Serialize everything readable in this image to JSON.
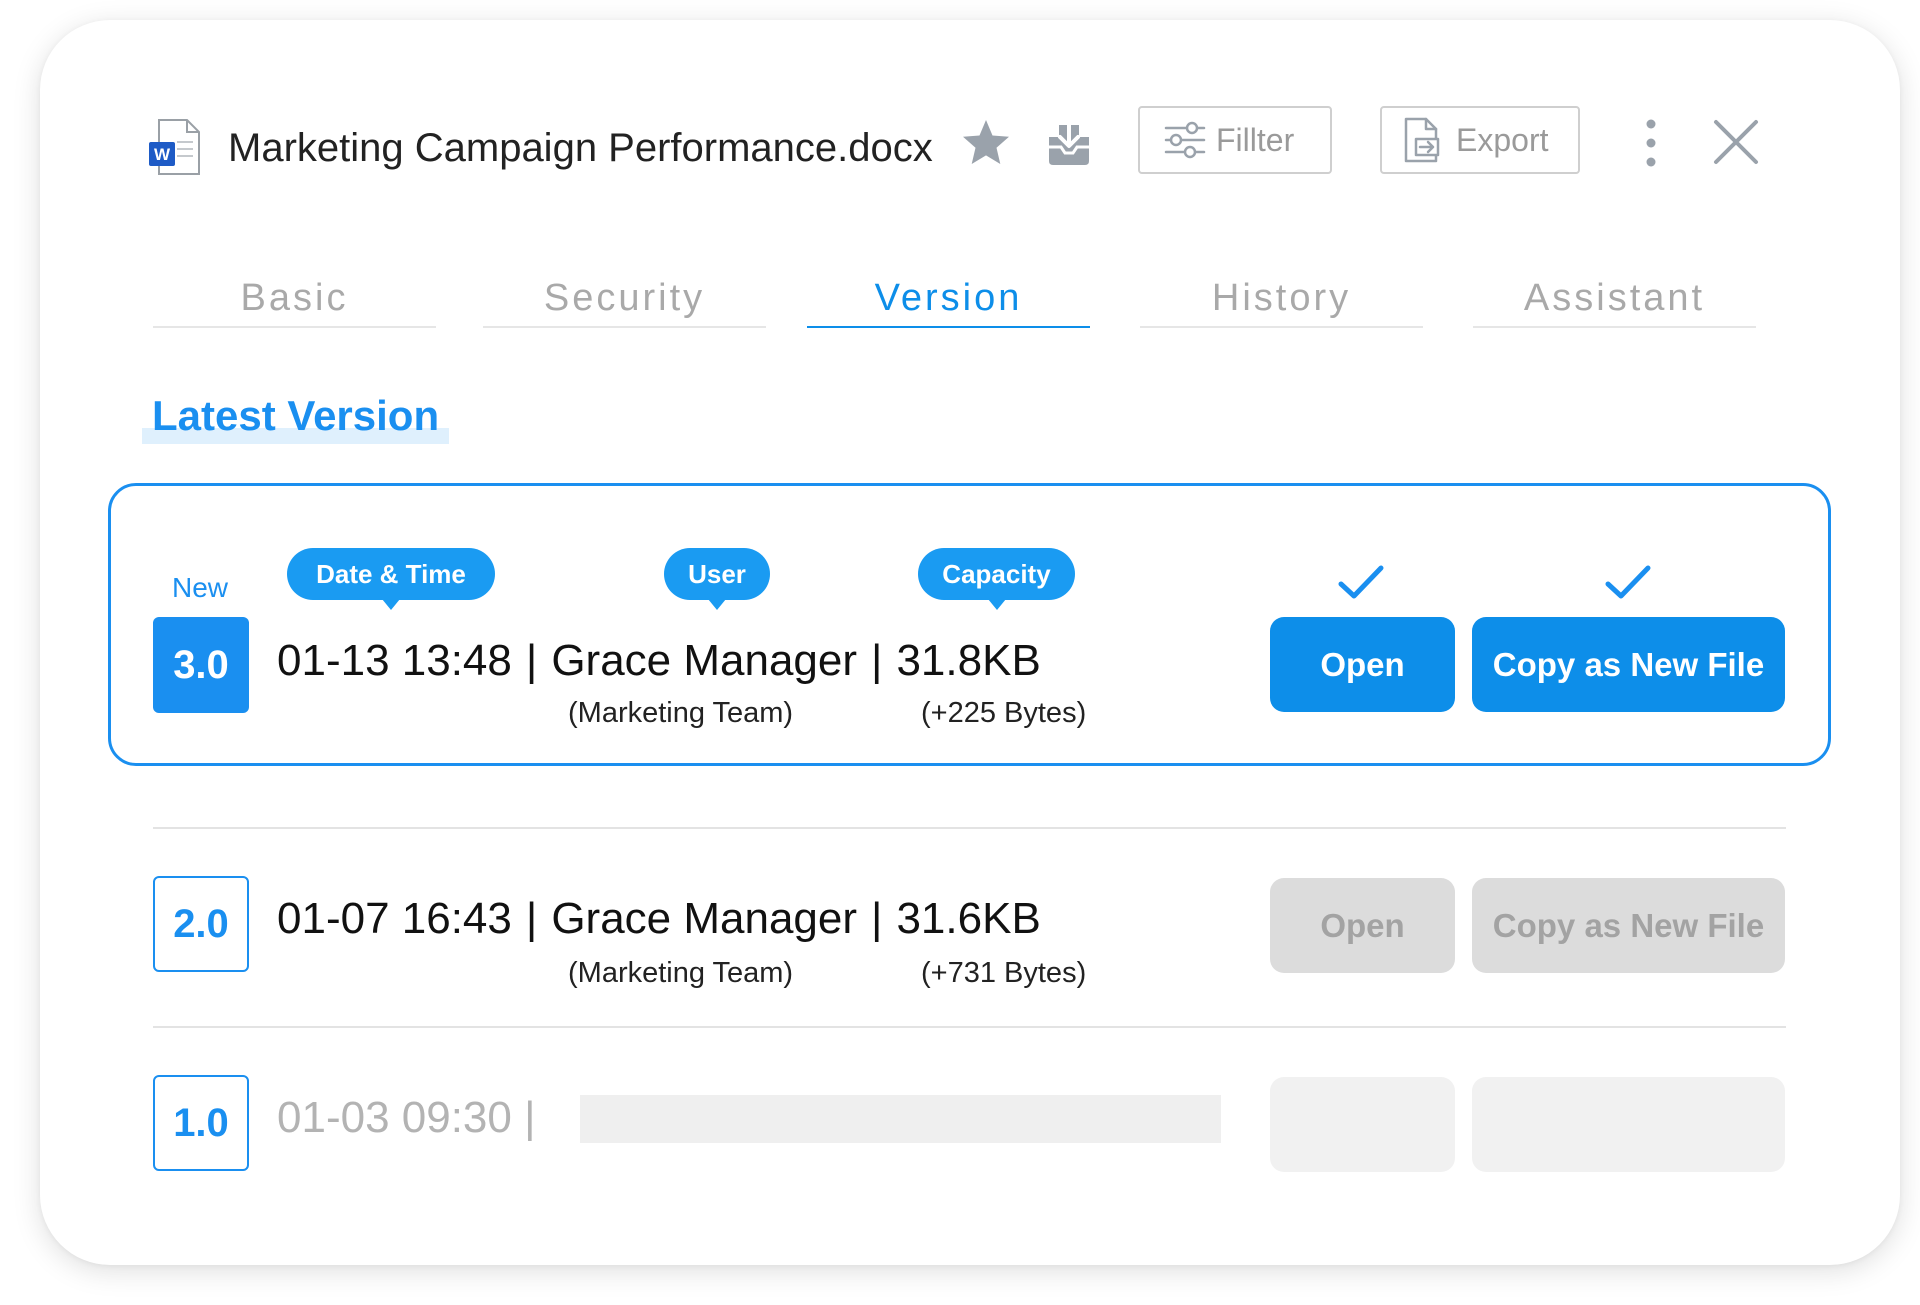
{
  "header": {
    "file_name": "Marketing Campaign Performance.docx",
    "doc_icon_letter": "W",
    "filter_label": "Fillter",
    "export_label": "Export",
    "icons": [
      "word-doc-icon",
      "star-icon",
      "download-icon",
      "filter-icon",
      "export-icon",
      "more-vertical-icon",
      "close-icon"
    ]
  },
  "tabs": [
    {
      "label": "Basic",
      "active": false
    },
    {
      "label": "Security",
      "active": false
    },
    {
      "label": "Version",
      "active": true
    },
    {
      "label": "History",
      "active": false
    },
    {
      "label": "Assistant",
      "active": false
    }
  ],
  "section_title": "Latest Version",
  "latest": {
    "new_label": "New",
    "version": "3.0",
    "tags": {
      "datetime": "Date & Time",
      "user": "User",
      "capacity": "Capacity"
    },
    "datetime": "01-13 13:48",
    "user": "Grace Manager",
    "team": "(Marketing Team)",
    "size": "31.8KB",
    "size_delta": "(+225 Bytes)",
    "open_label": "Open",
    "copy_label": "Copy as New File"
  },
  "versions": [
    {
      "version": "2.0",
      "datetime": "01-07 16:43",
      "user": "Grace Manager",
      "team": "(Marketing Team)",
      "size": "31.6KB",
      "size_delta": "(+731 Bytes)",
      "open_label": "Open",
      "copy_label": "Copy as New File"
    },
    {
      "version": "1.0",
      "datetime": "01-03 09:30 |"
    }
  ],
  "separator": "|",
  "colors": {
    "accent": "#1a8ff0",
    "button_primary": "#0d8ee9",
    "disabled": "#dcdcdc"
  }
}
